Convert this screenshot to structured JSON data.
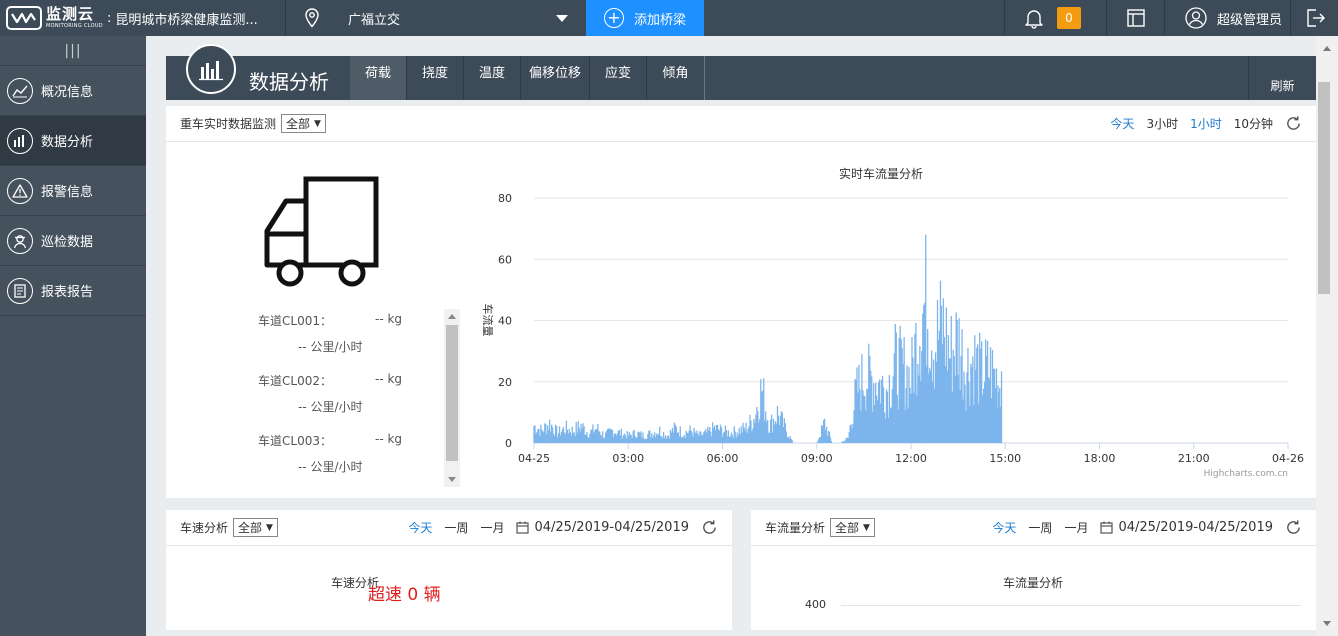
{
  "header": {
    "logo_main": "监测云",
    "logo_sub": "MONITORING CLOUD",
    "logo_separator": ":",
    "app_title": "昆明城市桥梁健康监测...",
    "bridge_name": "广福立交",
    "add_bridge_label": "添加桥梁",
    "notification_count": "0",
    "user_name": "超级管理员"
  },
  "sidebar": {
    "collapse_label": "|||",
    "items": [
      {
        "label": "概况信息",
        "icon": "chart-line-icon"
      },
      {
        "label": "数据分析",
        "icon": "bar-chart-icon",
        "active": true
      },
      {
        "label": "报警信息",
        "icon": "warning-icon"
      },
      {
        "label": "巡检数据",
        "icon": "inspector-icon"
      },
      {
        "label": "报表报告",
        "icon": "report-icon"
      }
    ]
  },
  "section": {
    "title": "数据分析",
    "tabs": [
      "荷载",
      "挠度",
      "温度",
      "偏移位移",
      "应变",
      "倾角"
    ],
    "active_tab": "荷载",
    "refresh_label": "刷新"
  },
  "heavy_panel": {
    "title": "重车实时数据监测",
    "select_value": "全部",
    "filters": [
      "今天",
      "3小时",
      "1小时",
      "10分钟"
    ],
    "lanes": [
      {
        "name": "车道CL001：",
        "weight": "-- kg",
        "speed": "-- 公里/小时"
      },
      {
        "name": "车道CL002：",
        "weight": "-- kg",
        "speed": "-- 公里/小时"
      },
      {
        "name": "车道CL003：",
        "weight": "-- kg",
        "speed": "-- 公里/小时"
      }
    ]
  },
  "speed_panel": {
    "title": "车速分析",
    "select_value": "全部",
    "filters": [
      "今天",
      "一周",
      "一月"
    ],
    "date_range": "04/25/2019-04/25/2019",
    "chart_title": "车速分析",
    "overspeed_text": "超速   0 辆"
  },
  "flow_panel": {
    "title": "车流量分析",
    "select_value": "全部",
    "filters": [
      "今天",
      "一周",
      "一月"
    ],
    "date_range": "04/25/2019-04/25/2019",
    "chart_title": "车流量分析",
    "first_tick": "400"
  },
  "chart_data": {
    "type": "area",
    "title": "实时车流量分析",
    "xlabel": "",
    "ylabel": "车流量",
    "ylim": [
      0,
      80
    ],
    "yticks": [
      0,
      20,
      40,
      60,
      80
    ],
    "xticks": [
      "04-25",
      "03:00",
      "06:00",
      "09:00",
      "12:00",
      "15:00",
      "18:00",
      "21:00",
      "04-26"
    ],
    "x_unit": "hour",
    "xlim": [
      0,
      24
    ],
    "color": "#7cb5ec",
    "credit": "Highcharts.com.cn",
    "series": [
      {
        "x": [
          0.0,
          0.25,
          0.5,
          0.75,
          1.0,
          1.25,
          1.5,
          1.75,
          2.0,
          2.25,
          2.5,
          2.75,
          3.0,
          3.25,
          3.5,
          3.75,
          4.0,
          4.25,
          4.5,
          4.75,
          5.0,
          5.25,
          5.5,
          5.75,
          6.0,
          6.25,
          6.5,
          6.75,
          7.0,
          7.25,
          7.5,
          7.75,
          8.0,
          8.25,
          8.5,
          8.75,
          9.0,
          9.25,
          9.5,
          9.75,
          10.0,
          10.25,
          10.5,
          10.75,
          11.0,
          11.25,
          11.5,
          11.75,
          12.0,
          12.25,
          12.5,
          12.75,
          13.0,
          13.25,
          13.5,
          13.75,
          14.0,
          14.25,
          14.5,
          14.75,
          14.9
        ],
        "y": [
          7,
          5,
          8,
          4,
          6,
          5,
          7,
          4,
          6,
          3,
          5,
          4,
          3,
          4,
          3,
          4,
          5,
          3,
          6,
          4,
          5,
          3,
          4,
          6,
          5,
          4,
          5,
          6,
          10,
          22,
          7,
          12,
          6,
          0,
          0,
          0,
          0,
          8,
          0,
          0,
          2,
          20,
          27,
          26,
          24,
          22,
          32,
          30,
          26,
          48,
          58,
          40,
          48,
          36,
          42,
          30,
          34,
          28,
          30,
          26,
          18
        ]
      }
    ]
  }
}
